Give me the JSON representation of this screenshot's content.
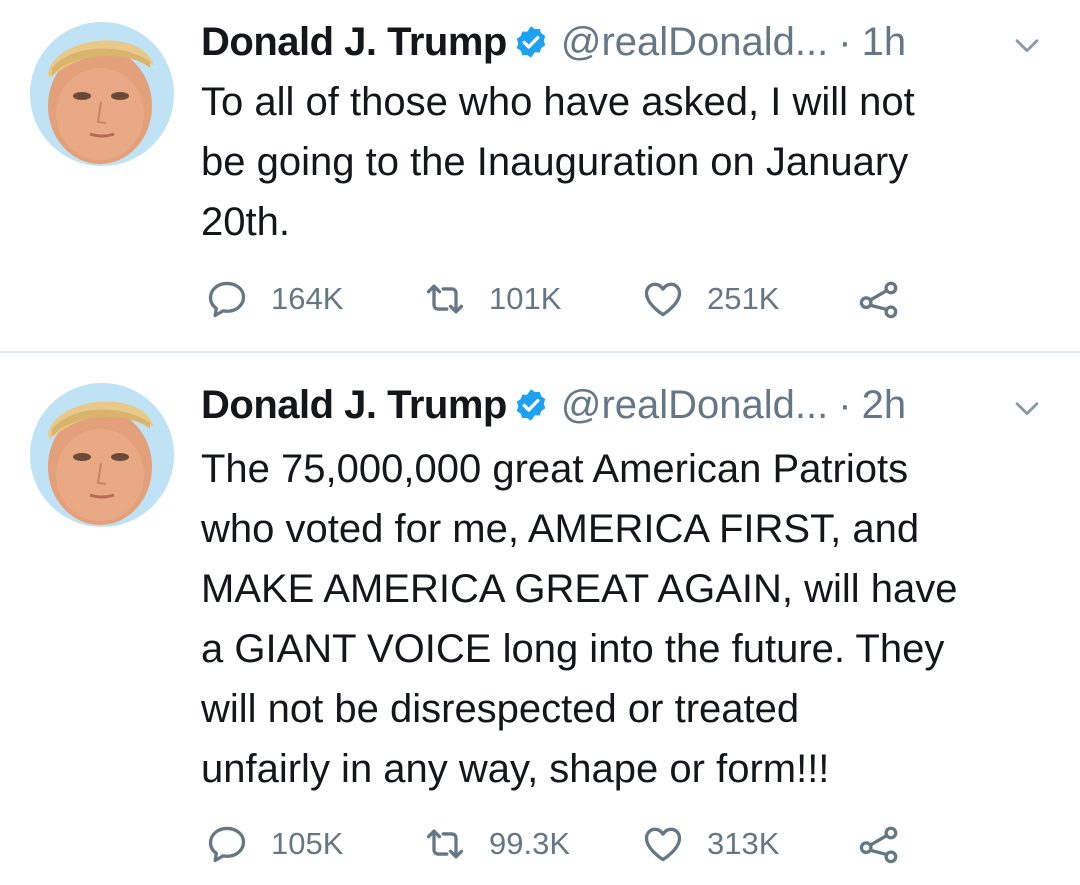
{
  "tweets": [
    {
      "name": "Donald J. Trump",
      "handle": "@realDonald...",
      "separator": "·",
      "time": "1h",
      "text": "To all of those who have asked, I will not\nbe going to the Inauguration on January\n20th.",
      "replies": "164K",
      "retweets": "101K",
      "likes": "251K"
    },
    {
      "name": "Donald J. Trump",
      "handle": "@realDonald...",
      "separator": "·",
      "time": "2h",
      "text": "The 75,000,000 great American Patriots\nwho voted for me, AMERICA FIRST, and\nMAKE AMERICA GREAT AGAIN, will have\na GIANT VOICE long into the future. They\nwill not be disrespected or treated\nunfairly in any way, shape or form!!!",
      "replies": "105K",
      "retweets": "99.3K",
      "likes": "313K"
    }
  ],
  "icons": {
    "verified": "verified-badge-icon",
    "chevron": "chevron-down-icon",
    "reply": "reply-icon",
    "retweet": "retweet-icon",
    "like": "heart-icon",
    "share": "share-icon"
  },
  "colors": {
    "text": "#14171a",
    "secondary": "#657786",
    "verified": "#1da1f2",
    "divider": "#e1e8ed"
  }
}
